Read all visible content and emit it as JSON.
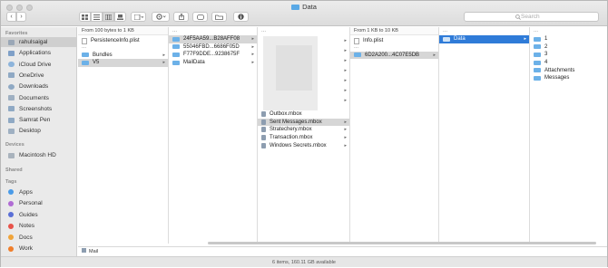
{
  "window": {
    "title": "Data"
  },
  "toolbar": {
    "back": "‹",
    "forward": "›",
    "view_icons": [
      "icon-view-icon",
      "list-view-icon",
      "column-view-icon",
      "gallery-view-icon"
    ],
    "search_placeholder": "Search"
  },
  "sidebar": {
    "favorites_label": "Favorites",
    "favorites": [
      "rahulsaigal",
      "Applications",
      "iCloud Drive",
      "OneDrive",
      "Downloads",
      "Documents",
      "Screenshots",
      "Samrat Pen",
      "Desktop"
    ],
    "devices_label": "Devices",
    "devices": [
      "Macintosh HD"
    ],
    "shared_label": "Shared",
    "tags_label": "Tags",
    "tags": [
      {
        "label": "Apps",
        "color": "#4a9be8"
      },
      {
        "label": "Personal",
        "color": "#b06cd4"
      },
      {
        "label": "Guides",
        "color": "#5a6fd6"
      },
      {
        "label": "Notes",
        "color": "#e8534a"
      },
      {
        "label": "Docs",
        "color": "#f0a43a"
      },
      {
        "label": "Work",
        "color": "#f07e2a"
      }
    ]
  },
  "columns": {
    "col1": {
      "header": "From 100 bytes to 1 KB",
      "items": [
        "PersistenceInfo.plist",
        "Bundles",
        "V5"
      ]
    },
    "col2": {
      "items": [
        "24F5AA59...B28AFF08",
        "55046FBD...6686F05D",
        "F77F9DDE...9238675F",
        "MailData"
      ]
    },
    "col3": {
      "items": [
        "Outbox.mbox",
        "Sent Messages.mbox",
        "Stratechery.mbox",
        "Transaction.mbox",
        "Windows Secrets.mbox"
      ]
    },
    "col4": {
      "header": "From 1 KB to 10 KB",
      "items": [
        "Info.plist",
        "6D2A200...4C07E5DB"
      ]
    },
    "col5": {
      "items": [
        "Data"
      ]
    },
    "col6": {
      "items": [
        "1",
        "2",
        "3",
        "4",
        "Attachments",
        "Messages"
      ]
    }
  },
  "pathbar": {
    "item": "Mail"
  },
  "status": {
    "text": "6 items, 160.11 GB available"
  }
}
